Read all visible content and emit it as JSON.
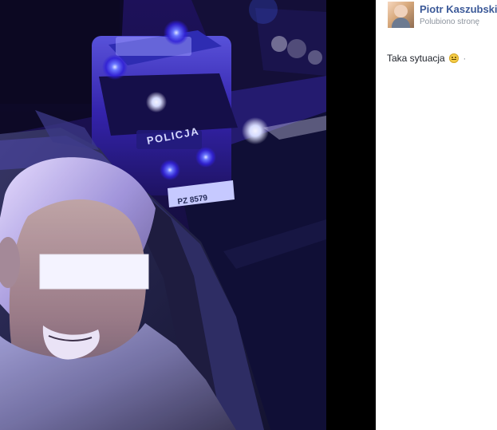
{
  "post": {
    "author_name": "Piotr Kaszubski",
    "author_meta": "Polubiono stronę",
    "caption": "Taka sytuacja",
    "caption_suffix": "·",
    "emoji": "slight-smile-icon"
  },
  "photo": {
    "van_label": "POLICJA",
    "plate_text": "PZ 8579",
    "accent_color": "#4b32ff"
  }
}
